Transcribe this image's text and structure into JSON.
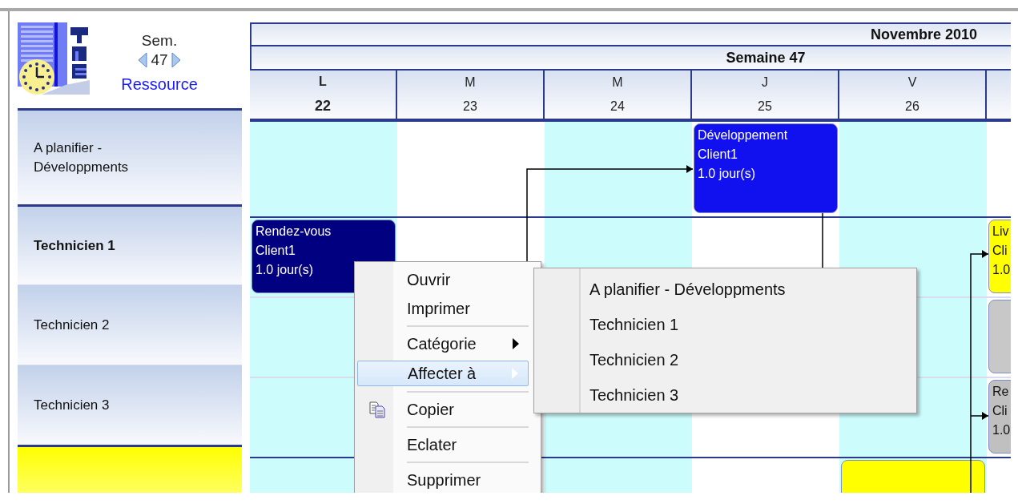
{
  "navigator": {
    "week_label": "Sem.",
    "week_number": "47",
    "resource_link": "Ressource"
  },
  "header": {
    "month": "Novembre 2010",
    "week": "Semaine 47",
    "days": [
      {
        "letter": "L",
        "date": "22",
        "selected": true,
        "shaded": true
      },
      {
        "letter": "M",
        "date": "23",
        "selected": false,
        "shaded": false
      },
      {
        "letter": "M",
        "date": "24",
        "selected": false,
        "shaded": true
      },
      {
        "letter": "J",
        "date": "25",
        "selected": false,
        "shaded": false
      },
      {
        "letter": "V",
        "date": "26",
        "selected": false,
        "shaded": true
      }
    ]
  },
  "rows": [
    {
      "kind": "queue",
      "label": "A planifier - Développments",
      "selected": false
    },
    {
      "kind": "resource",
      "label": "Technicien 1",
      "selected": true
    },
    {
      "kind": "resource",
      "label": "Technicien 2",
      "selected": false
    },
    {
      "kind": "resource",
      "label": "Technicien 3",
      "selected": false
    },
    {
      "kind": "highlight"
    }
  ],
  "events": [
    {
      "color": "#1111f0",
      "lines": [
        "Développement",
        "Client1",
        "1.0 jour(s)"
      ]
    },
    {
      "color": "#000080",
      "lines": [
        "Rendez-vous",
        "Client1",
        "1.0 jour(s)"
      ]
    },
    {
      "color": "#ffff00",
      "lines": [
        "Liv",
        "Cli",
        "1.0"
      ]
    },
    {
      "color": "#c8c8c8"
    },
    {
      "color": "#c0c0c0",
      "lines": [
        "Re",
        "Cli",
        "1.0"
      ]
    },
    {
      "color": "#ffff00"
    }
  ],
  "context_menu": {
    "items": [
      {
        "kind": "command",
        "label": "Ouvrir",
        "selected": false
      },
      {
        "kind": "command",
        "label": "Imprimer",
        "selected": false
      },
      {
        "kind": "separator"
      },
      {
        "kind": "submenu",
        "label": "Catégorie",
        "selected": false
      },
      {
        "kind": "submenu",
        "label": "Affecter à",
        "selected": true
      },
      {
        "kind": "separator"
      },
      {
        "kind": "icon-command",
        "label": "Copier",
        "selected": false
      },
      {
        "kind": "separator"
      },
      {
        "kind": "command",
        "label": "Eclater",
        "selected": false
      },
      {
        "kind": "separator"
      },
      {
        "kind": "command",
        "label": "Supprimer",
        "selected": false
      }
    ]
  },
  "submenu": {
    "items": [
      {
        "label": "A planifier - Développments",
        "selected": false
      },
      {
        "label": "Technicien 1",
        "selected": false
      },
      {
        "label": "Technicien 2",
        "selected": false
      },
      {
        "label": "Technicien 3",
        "selected": false
      }
    ]
  }
}
